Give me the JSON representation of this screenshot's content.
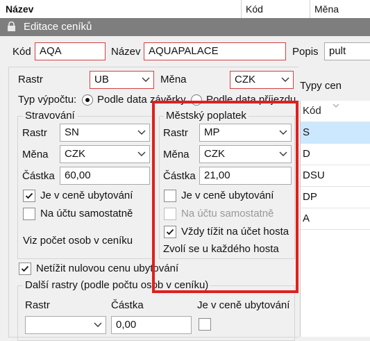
{
  "background_table": {
    "col_nazev": "Název",
    "col_kod": "Kód",
    "col_mena": "Měna"
  },
  "window": {
    "title": "Editace ceníků"
  },
  "top": {
    "kod_label": "Kód",
    "kod_value": "AQA",
    "nazev_label": "Název",
    "nazev_value": "AQUAPALACE",
    "popis_label": "Popis",
    "popis_value": "pult"
  },
  "main": {
    "rastr_label": "Rastr",
    "rastr_value": "UB",
    "mena_label": "Měna",
    "mena_value": "CZK",
    "typ_label": "Typ výpočtu:",
    "radio_zaverky": "Podle data závěrky",
    "radio_prijezdu": "Podle data příjezdu"
  },
  "stravovani": {
    "legend": "Stravování",
    "rastr_label": "Rastr",
    "rastr_value": "SN",
    "mena_label": "Měna",
    "mena_value": "CZK",
    "castka_label": "Částka",
    "castka_value": "60,00",
    "cb_v_cene": "Je v ceně ubytování",
    "cb_v_cene_checked": true,
    "cb_samostatne": "Na účtu samostatně",
    "cb_samostatne_checked": false,
    "note": "Viz počet osob v ceníku"
  },
  "mestsky": {
    "legend": "Městský poplatek",
    "rastr_label": "Rastr",
    "rastr_value": "MP",
    "mena_label": "Měna",
    "mena_value": "CZK",
    "castka_label": "Částka",
    "castka_value": "21,00",
    "cb_v_cene": "Je v ceně ubytování",
    "cb_v_cene_checked": false,
    "cb_samostatne": "Na účtu samostatně",
    "cb_samostatne_checked": false,
    "cb_tizit": "Vždy tížit na účet hosta",
    "cb_tizit_checked": true,
    "note": "Zvolí se u každého hosta"
  },
  "netizit": {
    "label": "Netížit nulovou cenu ubytování",
    "checked": true
  },
  "dalsi": {
    "legend": "Další rastry (podle počtu osob v ceníku)",
    "col_rastr": "Rastr",
    "col_castka": "Částka",
    "col_v_cene": "Je v ceně ubytování",
    "castka_value": "0,00"
  },
  "typy_cen": {
    "label": "Typy cen",
    "header": "Kód",
    "rows": [
      "S",
      "D",
      "DSU",
      "DP",
      "A"
    ],
    "selected_color": "#cce8ff"
  },
  "highlight_color": "#e02020"
}
